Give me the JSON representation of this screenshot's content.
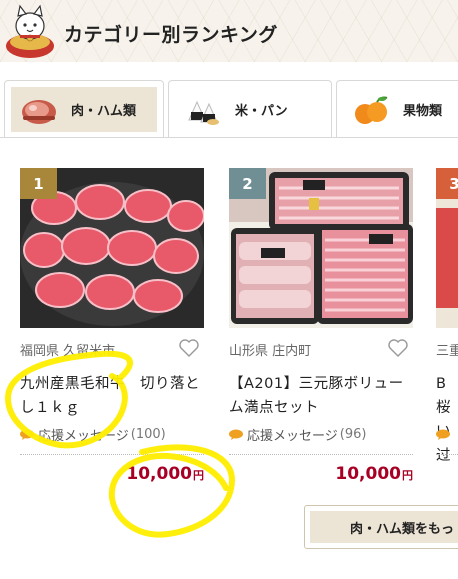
{
  "header": {
    "title": "カテゴリー別ランキング"
  },
  "tabs": [
    {
      "label": "肉・ハム類",
      "icon": "ham-icon",
      "active": true
    },
    {
      "label": "米・パン",
      "icon": "rice-icon",
      "active": false
    },
    {
      "label": "果物類",
      "icon": "orange-icon",
      "active": false
    }
  ],
  "cards": [
    {
      "rank": "1",
      "rank_color": "#a8873a",
      "location": "福岡県 久留米市",
      "title": "九州産黒毛和牛　切り落とし１ｋｇ",
      "support_label": "応援メッセージ",
      "support_count": "(100)",
      "price": "10,000",
      "price_unit": "円"
    },
    {
      "rank": "2",
      "rank_color": "#6f8f95",
      "location": "山形県 庄内町",
      "title": "【A201】三元豚ボリューム満点セット",
      "support_label": "応援メッセージ",
      "support_count": "(96)",
      "price": "10,000",
      "price_unit": "円"
    },
    {
      "rank": "3",
      "rank_color": "#d5603a",
      "location": "三重",
      "title": "B桜い过"
    }
  ],
  "more_button": {
    "label": "肉・ハム類をもっ"
  },
  "colors": {
    "accent_bg": "#ece4d5",
    "price": "#a80024",
    "highlight": "#ffee00"
  }
}
